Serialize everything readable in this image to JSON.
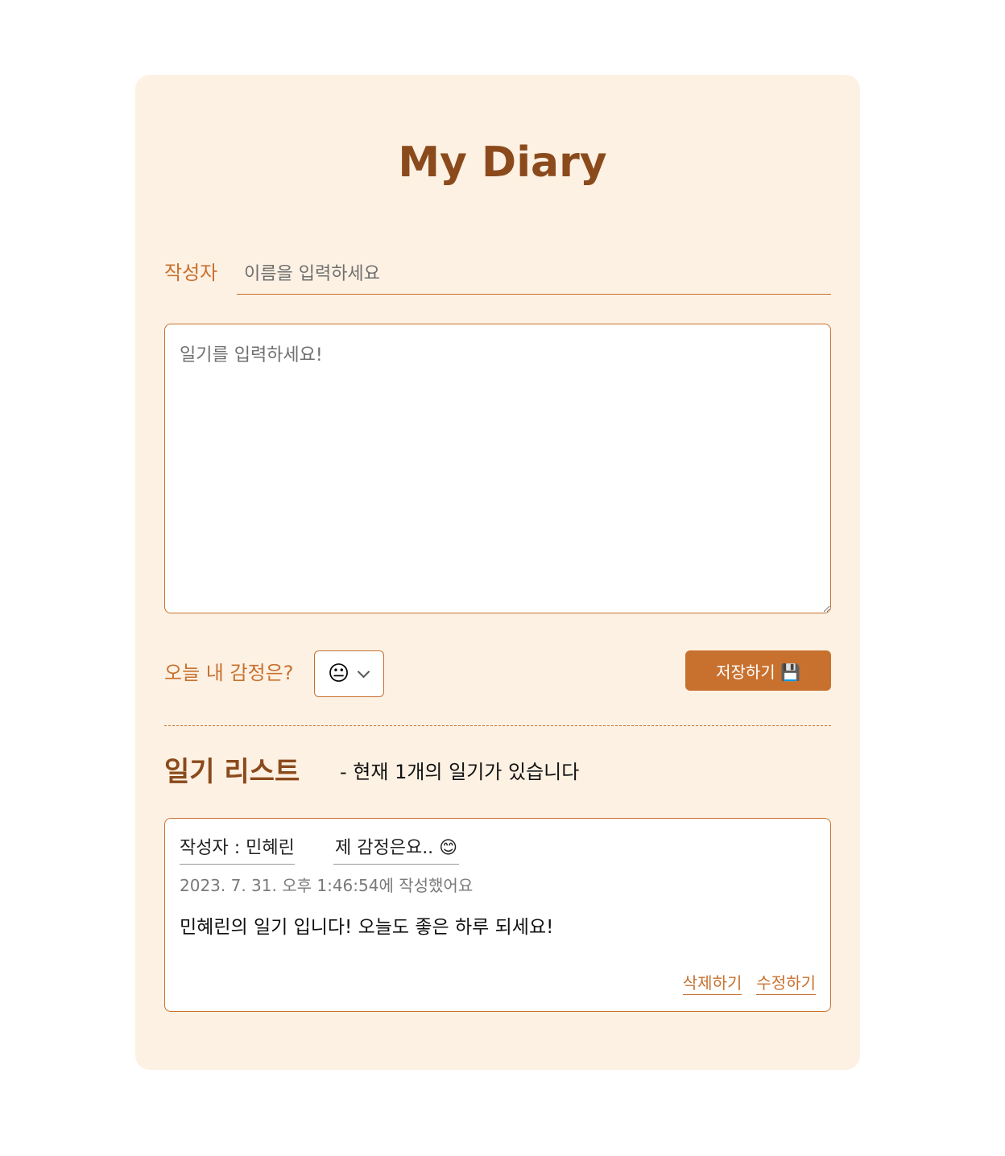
{
  "header": {
    "title": "My Diary"
  },
  "form": {
    "author_label": "작성자",
    "author_placeholder": "이름을 입력하세요",
    "content_placeholder": "일기를 입력하세요!",
    "emotion_label": "오늘 내 감정은?",
    "emotion_selected": "😐",
    "save_label": "저장하기 💾"
  },
  "list": {
    "title": "일기 리스트",
    "count_text": "- 현재 1개의 일기가 있습니다",
    "entries": [
      {
        "author": "작성자 : 민혜린",
        "emotion": "제 감정은요.. 😊",
        "date": "2023. 7. 31. 오후 1:46:54에 작성했어요",
        "content": "민혜린의 일기 입니다! 오늘도 좋은 하루 되세요!",
        "delete_label": "삭제하기",
        "edit_label": "수정하기"
      }
    ]
  },
  "colors": {
    "accent": "#c8712f",
    "title": "#8b4a1c",
    "card_bg": "#fdf1e3"
  }
}
